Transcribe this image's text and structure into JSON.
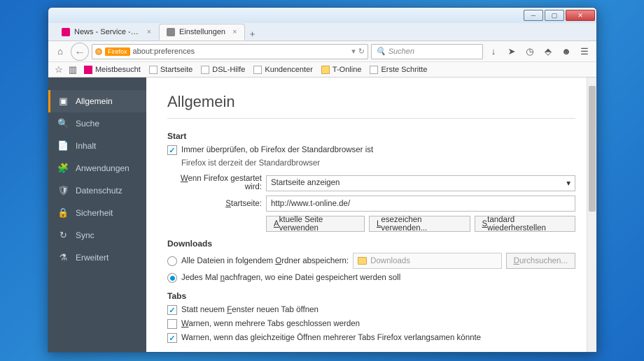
{
  "tabs": [
    {
      "label": "News - Service - Shopping ...",
      "active": false,
      "favcolor": "#e20074"
    },
    {
      "label": "Einstellungen",
      "active": true,
      "favcolor": "#888"
    }
  ],
  "url": "about:preferences",
  "url_scheme": "Firefox",
  "search_placeholder": "Suchen",
  "bookmarks": {
    "meist": "Meistbesucht",
    "start": "Startseite",
    "dsl": "DSL-Hilfe",
    "kunden": "Kundencenter",
    "tonline": "T-Online",
    "erste": "Erste Schritte"
  },
  "sidebar": [
    {
      "key": "general",
      "label": "Allgemein",
      "active": true
    },
    {
      "key": "search",
      "label": "Suche"
    },
    {
      "key": "content",
      "label": "Inhalt"
    },
    {
      "key": "apps",
      "label": "Anwendungen"
    },
    {
      "key": "privacy",
      "label": "Datenschutz"
    },
    {
      "key": "security",
      "label": "Sicherheit"
    },
    {
      "key": "sync",
      "label": "Sync"
    },
    {
      "key": "advanced",
      "label": "Erweitert"
    }
  ],
  "page": {
    "title": "Allgemein",
    "start_h": "Start",
    "defcheck": "Immer überprüfen, ob Firefox der Standardbrowser ist",
    "defstatus": "Firefox ist derzeit der Standardbrowser",
    "whenstart_lbl": "Wenn Firefox gestartet wird:",
    "whenstart_val": "Startseite anzeigen",
    "home_lbl": "Startseite:",
    "home_val": "http://www.t-online.de/",
    "btn_current": "Aktuelle Seite verwenden",
    "btn_bookmark": "Lesezeichen verwenden...",
    "btn_restore": "Standard wiederherstellen",
    "dl_h": "Downloads",
    "dl_saveall": "Alle Dateien in folgendem Ordner abspeichern:",
    "dl_folder": "Downloads",
    "dl_browse": "Durchsuchen...",
    "dl_ask": "Jedes Mal nachfragen, wo eine Datei gespeichert werden soll",
    "tabs_h": "Tabs",
    "tabs_newtab": "Statt neuem Fenster neuen Tab öffnen",
    "tabs_warnclose": "Warnen, wenn mehrere Tabs geschlossen werden",
    "tabs_warnopen": "Warnen, wenn das gleichzeitige Öffnen mehrerer Tabs Firefox verlangsamen könnte"
  }
}
